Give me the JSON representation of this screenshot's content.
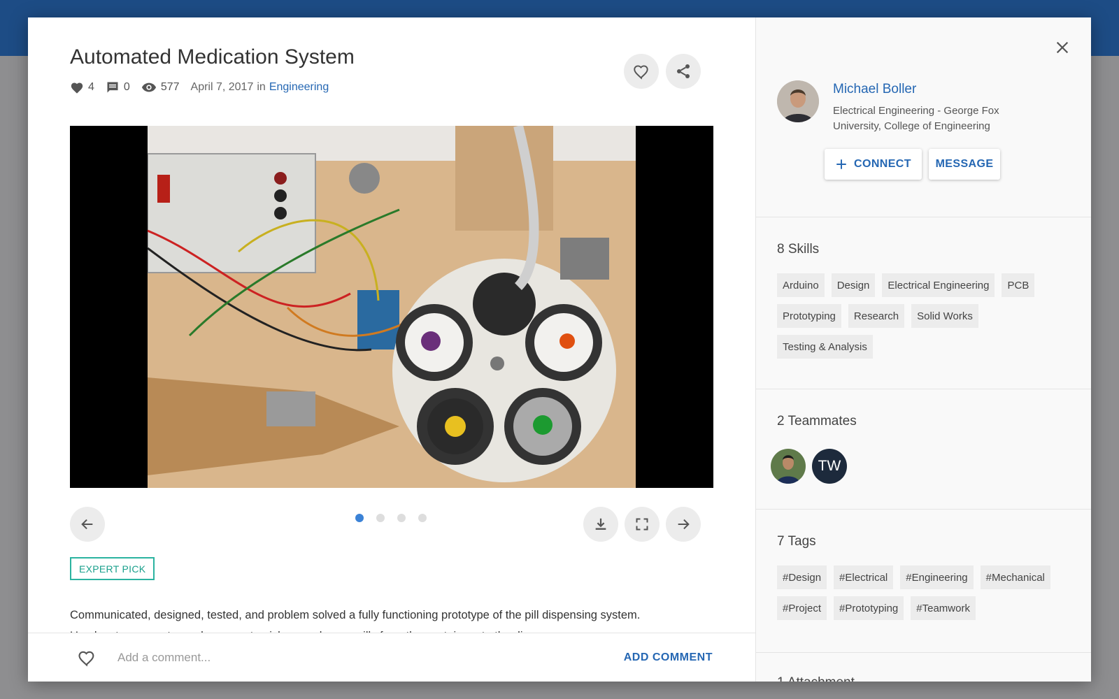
{
  "project": {
    "title": "Automated Medication System",
    "likes": "4",
    "comments": "0",
    "views": "577",
    "date": "April 7, 2017",
    "in_label": "in",
    "category": "Engineering",
    "badge": "EXPERT PICK",
    "description_lines": [
      "Communicated, designed, tested, and problem solved a fully functioning prototype of the pill dispensing system.",
      "Used a stepper motor and vacuum to pick up and move pills from the containers to the dispenser."
    ]
  },
  "gallery": {
    "slides": 4,
    "active": 1
  },
  "comment": {
    "placeholder": "Add a comment...",
    "submit": "ADD COMMENT"
  },
  "author": {
    "name": "Michael Boller",
    "affiliation": "Electrical Engineering - George Fox University, College of Engineering",
    "connect_label": "CONNECT",
    "message_label": "MESSAGE"
  },
  "skills": {
    "title": "8 Skills",
    "items": [
      "Arduino",
      "Design",
      "Electrical Engineering",
      "PCB",
      "Prototyping",
      "Research",
      "Solid Works",
      "Testing & Analysis"
    ]
  },
  "teammates": {
    "title": "2 Teammates",
    "initials": "TW"
  },
  "tags": {
    "title": "7 Tags",
    "items": [
      "#Design",
      "#Electrical",
      "#Engineering",
      "#Mechanical",
      "#Project",
      "#Prototyping",
      "#Teamwork"
    ]
  },
  "attachments": {
    "title": "1 Attachment"
  },
  "colors": {
    "accent": "#2567b3",
    "header": "#1d4c85",
    "badge": "#2bb3a0",
    "active_dot": "#3b82d6"
  },
  "icons": [
    "heart-icon",
    "comment-icon",
    "eye-icon",
    "share-icon",
    "arrow-left-icon",
    "arrow-right-icon",
    "download-icon",
    "fullscreen-icon",
    "close-icon",
    "plus-icon"
  ]
}
